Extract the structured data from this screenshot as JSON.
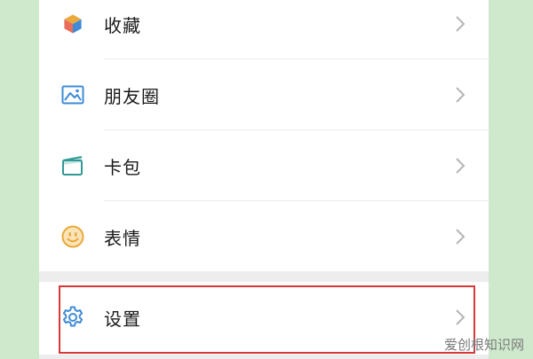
{
  "menu": {
    "items": [
      {
        "label": "收藏",
        "icon": "favorites-cube-icon"
      },
      {
        "label": "朋友圈",
        "icon": "moments-picture-icon"
      },
      {
        "label": "卡包",
        "icon": "card-wallet-icon"
      },
      {
        "label": "表情",
        "icon": "sticker-smiley-icon"
      },
      {
        "label": "设置",
        "icon": "settings-gear-icon"
      }
    ]
  },
  "highlight_color": "#d93838",
  "watermark": "爱创根知识网"
}
